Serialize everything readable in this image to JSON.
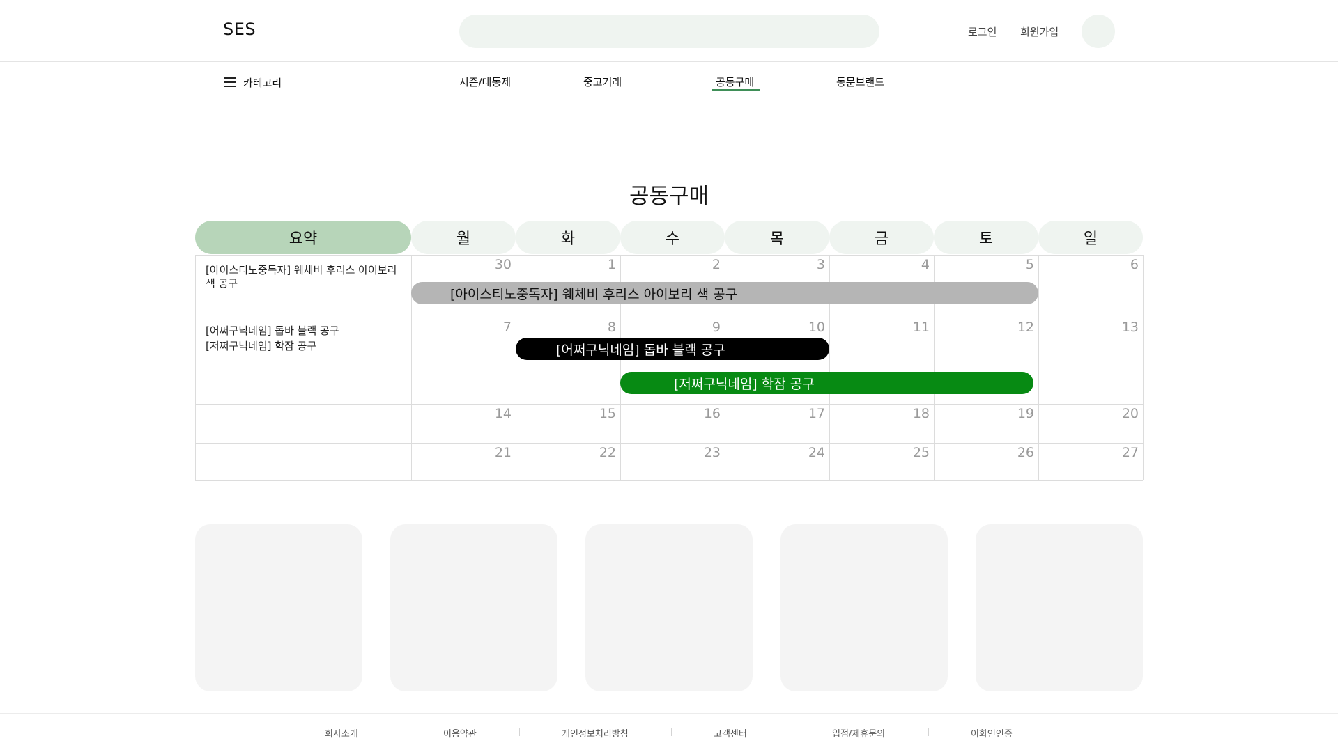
{
  "header": {
    "logo": "SES",
    "search_placeholder": "",
    "login": "로그인",
    "signup": "회원가입"
  },
  "nav": {
    "category": "카테고리",
    "items": [
      "시즌/대동제",
      "중고거래",
      "공동구매",
      "동문브랜드"
    ],
    "active": "공동구매"
  },
  "page": {
    "title": "공동구매"
  },
  "calendar": {
    "headers": [
      "요약",
      "월",
      "화",
      "수",
      "목",
      "금",
      "토",
      "일"
    ],
    "weeks": [
      {
        "days": [
          "30",
          "1",
          "2",
          "3",
          "4",
          "5",
          "6"
        ],
        "summary": [
          "[아이스티노중독자] 웨체비 후리스 아이보리 색 공구"
        ],
        "events": [
          {
            "label": "[아이스티노중독자] 웨체비 후리스 아이보리 색 공구",
            "color": "#b5b5b5",
            "text_color": "#111111"
          }
        ]
      },
      {
        "days": [
          "7",
          "8",
          "9",
          "10",
          "11",
          "12",
          "13"
        ],
        "summary": [
          "[어쩌구닉네임] 돕바 블랙 공구",
          "[저쩌구닉네임] 학잠 공구"
        ],
        "events": [
          {
            "label": "[어쩌구닉네임] 돕바 블랙 공구",
            "color": "#000000",
            "text_color": "#ffffff"
          },
          {
            "label": "[저쩌구닉네임] 학잠 공구",
            "color": "#078a13",
            "text_color": "#ffffff"
          }
        ]
      },
      {
        "days": [
          "14",
          "15",
          "16",
          "17",
          "18",
          "19",
          "20"
        ],
        "summary": [],
        "events": []
      },
      {
        "days": [
          "21",
          "22",
          "23",
          "24",
          "25",
          "26",
          "27"
        ],
        "summary": [],
        "events": []
      }
    ]
  },
  "footer": {
    "links": [
      "회사소개",
      "이용약관",
      "개인정보처리방침",
      "고객센터",
      "입점/제휴문의",
      "이화인인증"
    ]
  },
  "colors": {
    "accent": "#3f8f58",
    "summary_header": "#b7d5b9",
    "day_header": "#eff4f0",
    "card": "#f4f4f4"
  }
}
